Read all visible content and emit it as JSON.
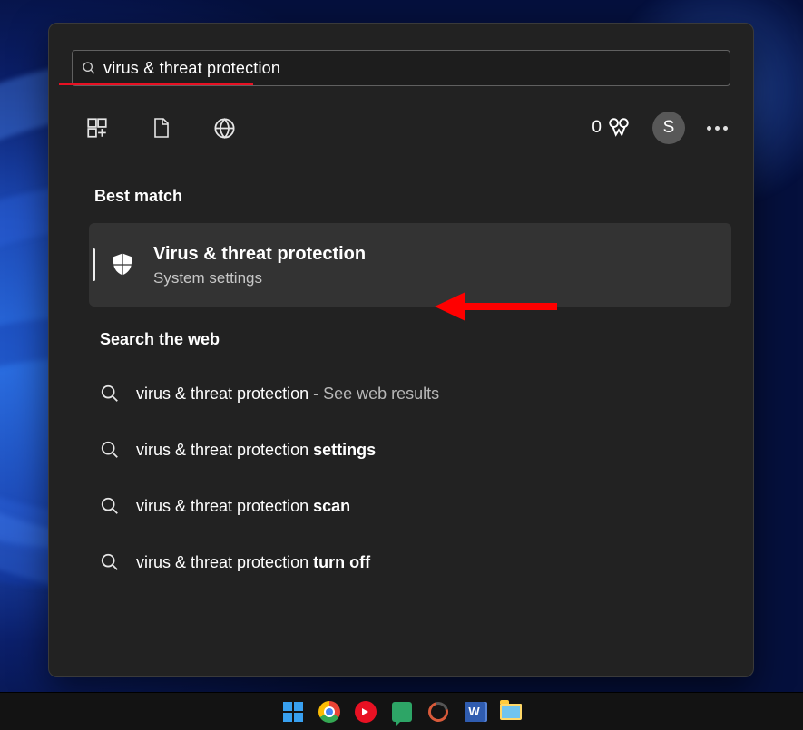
{
  "search": {
    "value": "virus & threat protection"
  },
  "rewards": {
    "count": "0"
  },
  "avatar": {
    "initial": "S"
  },
  "sections": {
    "best_match": "Best match",
    "web": "Search the web"
  },
  "best_match_result": {
    "title": "Virus & threat protection",
    "subtitle": "System settings"
  },
  "web_results": [
    {
      "prefix": "virus & threat protection",
      "suffix_dim": " - See web results",
      "suffix_bold": ""
    },
    {
      "prefix": "virus & threat protection ",
      "suffix_dim": "",
      "suffix_bold": "settings"
    },
    {
      "prefix": "virus & threat protection ",
      "suffix_dim": "",
      "suffix_bold": "scan"
    },
    {
      "prefix": "virus & threat protection ",
      "suffix_dim": "",
      "suffix_bold": "turn off"
    }
  ],
  "taskbar": {
    "items": [
      "start",
      "chrome",
      "youtube-music",
      "google-chat",
      "octosniffer",
      "word",
      "file-explorer"
    ]
  }
}
